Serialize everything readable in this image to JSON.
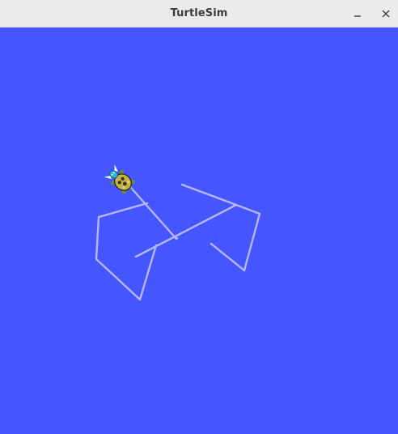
{
  "window": {
    "title": "TurtleSim",
    "buttons": [
      {
        "name": "minimize",
        "icon": "minimize-icon"
      },
      {
        "name": "close",
        "icon": "close-icon"
      }
    ]
  },
  "canvas": {
    "background_color": "#4556ff",
    "path_color": "#b3b8ff",
    "turtle_icon": "turtle-icon"
  }
}
